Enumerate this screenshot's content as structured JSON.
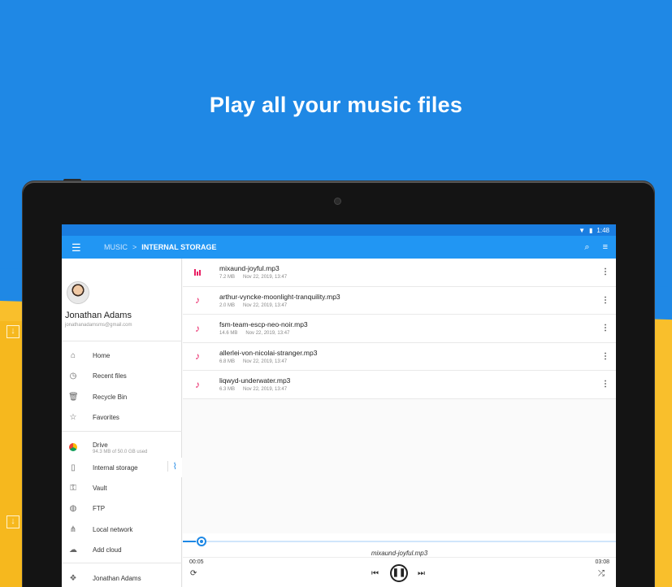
{
  "headline": "Play all your music files",
  "status": {
    "time": "1:48"
  },
  "appbar": {
    "breadcrumb_root": "MUSIC",
    "breadcrumb_sep": ">",
    "breadcrumb_current": "INTERNAL STORAGE"
  },
  "drawer": {
    "user_name": "Jonathan Adams",
    "user_email": "jonathanadamsms@gmail.com",
    "items": [
      {
        "label": "Home",
        "icon": "home-icon"
      },
      {
        "label": "Recent files",
        "icon": "clock-icon"
      },
      {
        "label": "Recycle Bin",
        "icon": "trash-icon"
      },
      {
        "label": "Favorites",
        "icon": "star-icon"
      }
    ],
    "storage": {
      "drive_label": "Drive",
      "drive_usage": "94.3 MB of 50.0 GB used",
      "internal_label": "Internal storage",
      "vault_label": "Vault",
      "ftp_label": "FTP",
      "local_label": "Local network",
      "cloud_label": "Add cloud",
      "dropbox_label": "Jonathan Adams"
    }
  },
  "files": [
    {
      "name": "mixaund-joyful.mp3",
      "size": "7.2 MB",
      "date": "Nov 22, 2019, 13:47",
      "playing": true
    },
    {
      "name": "arthur-vyncke-moonlight-tranquility.mp3",
      "size": "2.0 MB",
      "date": "Nov 22, 2019, 13:47",
      "playing": false
    },
    {
      "name": "fsm-team-escp-neo-noir.mp3",
      "size": "14.6 MB",
      "date": "Nov 22, 2019, 13:47",
      "playing": false
    },
    {
      "name": "allerlei-von-nicolai-stranger.mp3",
      "size": "6.8 MB",
      "date": "Nov 22, 2019, 13:47",
      "playing": false
    },
    {
      "name": "liqwyd-underwater.mp3",
      "size": "6.3 MB",
      "date": "Nov 22, 2019, 13:47",
      "playing": false
    }
  ],
  "player": {
    "title": "mixaund-joyful.mp3",
    "elapsed": "00:05",
    "duration": "03:08",
    "progress": 0.03
  },
  "colors": {
    "primary": "#2196f3",
    "accent": "#e91e63",
    "background_yellow": "#f9bf2c"
  }
}
